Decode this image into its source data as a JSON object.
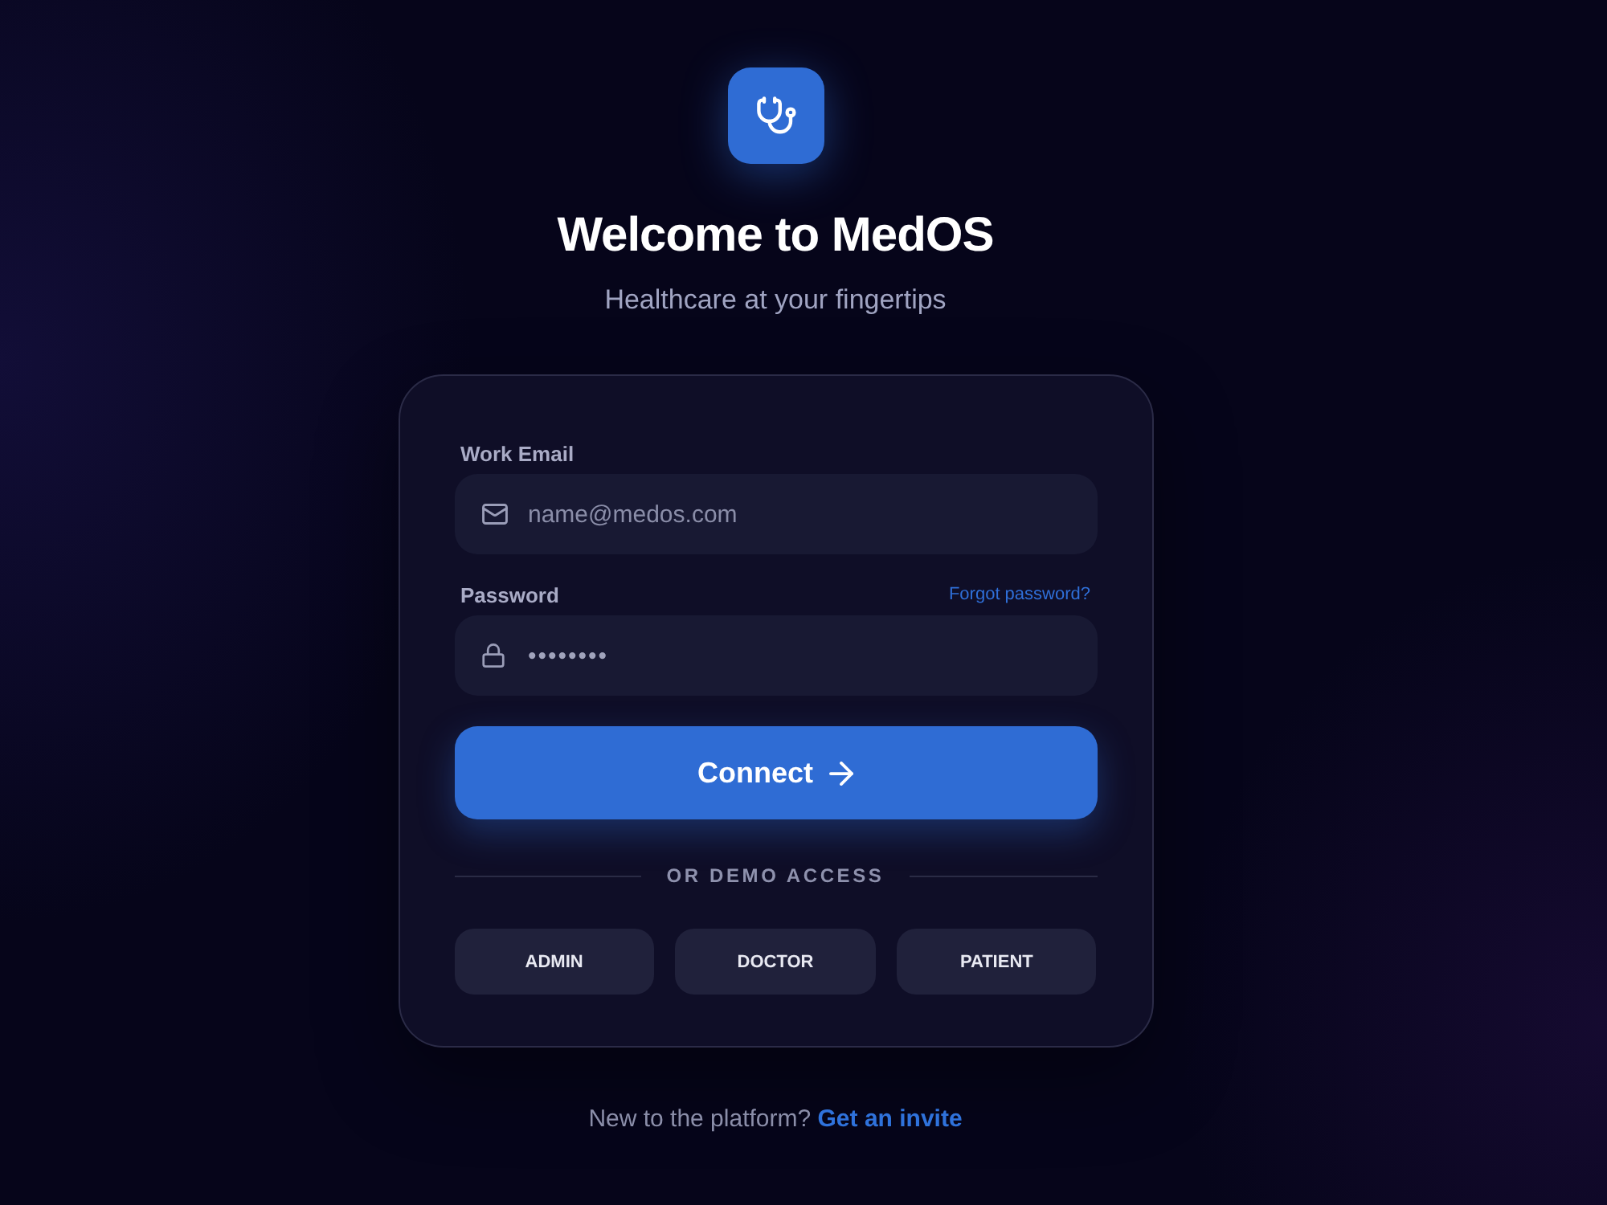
{
  "header": {
    "title": "Welcome to MedOS",
    "subtitle": "Healthcare at your fingertips"
  },
  "form": {
    "fields": [
      {
        "kind": "email",
        "label": "Work Email",
        "placeholder": "name@medos.com"
      },
      {
        "kind": "password",
        "label": "Password",
        "link": "Forgot password?",
        "placeholder": "••••••••"
      }
    ],
    "submit": {
      "label": "Connect"
    },
    "divider": "OR DEMO ACCESS",
    "demo_buttons": [
      "ADMIN",
      "DOCTOR",
      "PATIENT"
    ]
  },
  "footer": {
    "text": "New to the platform?",
    "link": "Get an invite"
  }
}
